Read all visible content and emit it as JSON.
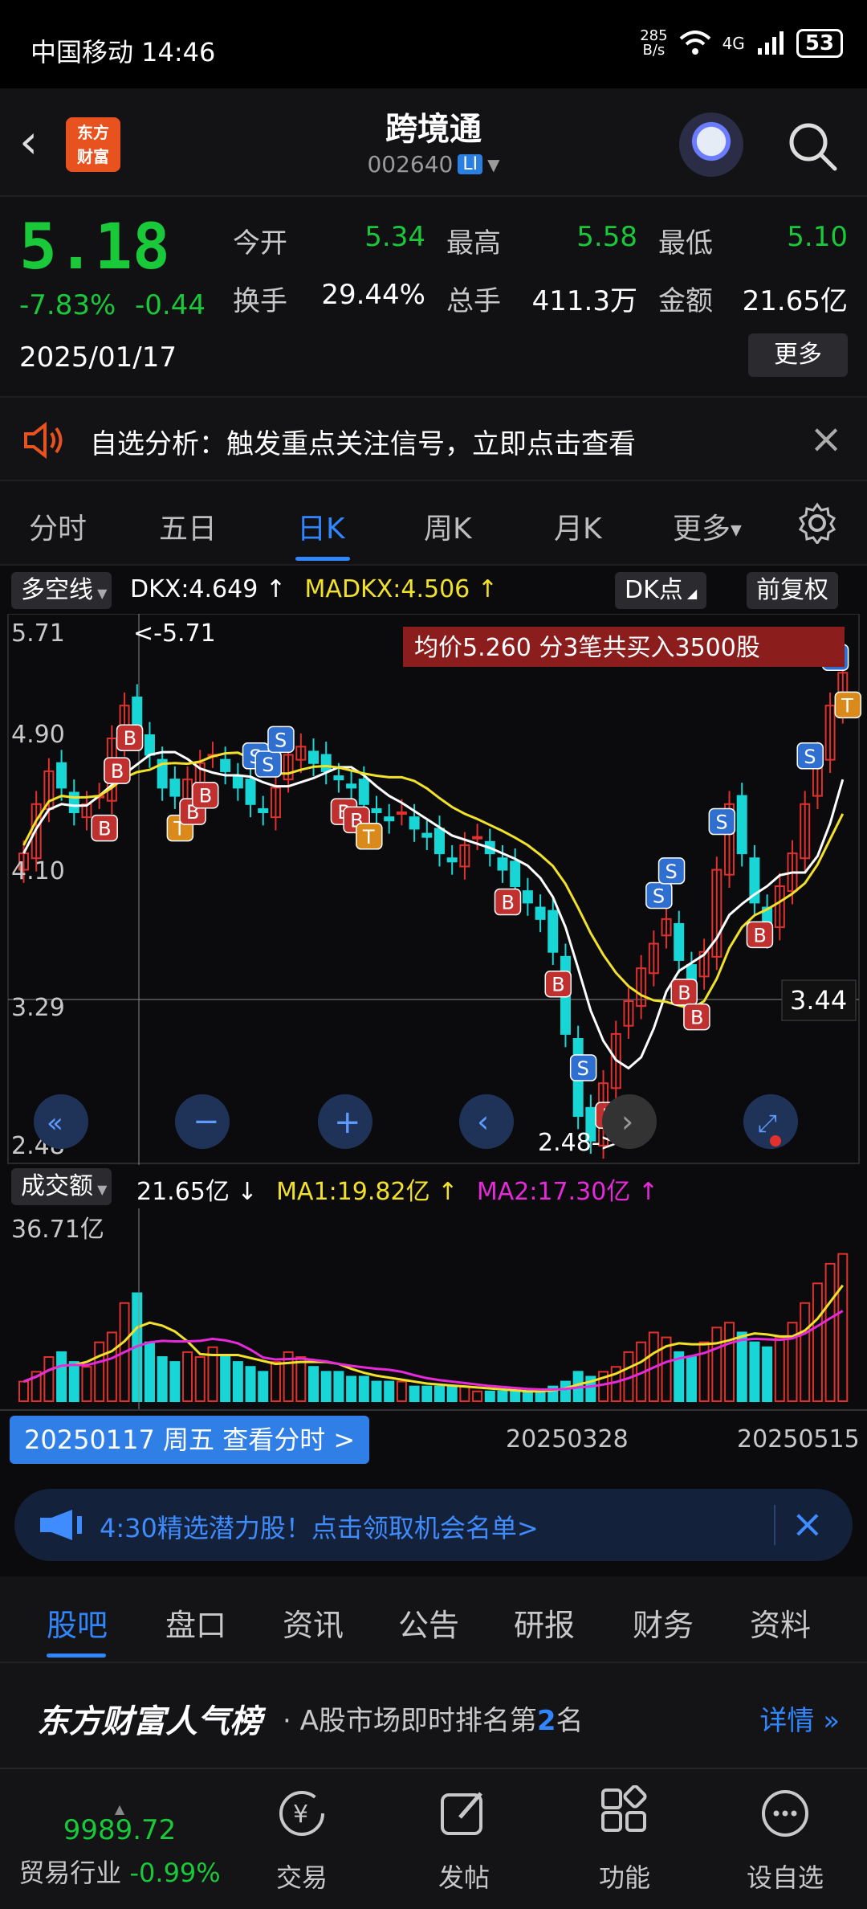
{
  "status_bar": {
    "carrier_time": "中国移动 14:46",
    "net_speed": "285\nB/s",
    "signal_label": "4G",
    "battery": "53"
  },
  "header": {
    "title": "跨境通",
    "code": "002640",
    "badge": "LI",
    "logo_text": "东方\n财富"
  },
  "quote": {
    "price": "5.18",
    "change_pct": "-7.83%",
    "change": "-0.44",
    "date": "2025/01/17",
    "open_label": "今开",
    "open": "5.34",
    "high_label": "最高",
    "high": "5.58",
    "low_label": "最低",
    "low": "5.10",
    "turnover_label": "换手",
    "turnover": "29.44%",
    "volume_label": "总手",
    "volume": "411.3万",
    "amount_label": "金额",
    "amount": "21.65亿",
    "more_label": "更多"
  },
  "notice": {
    "text": "自选分析：触发重点关注信号，立即点击查看"
  },
  "chart_tabs": [
    "分时",
    "五日",
    "日K",
    "周K",
    "月K",
    "更多"
  ],
  "indicator": {
    "selector": "多空线",
    "dkx": "DKX:4.649 ↑",
    "madkx": "MADKX:4.506 ↑",
    "dk_point": "DK点",
    "adjust": "前复权"
  },
  "price_axis": {
    "top": "5.71",
    "mid1": "4.90",
    "mid2": "4.10",
    "mid3": "3.29",
    "bottom": "2.48"
  },
  "annotations": {
    "high_marker": "<-5.71",
    "low_marker": "2.48->",
    "cursor_price": "3.44",
    "trade_banner": "均价5.260  分3笔共买入3500股"
  },
  "volume": {
    "selector": "成交额",
    "current": "21.65亿 ↓",
    "ma1": "MA1:19.82亿 ↑",
    "ma2": "MA2:17.30亿 ↑",
    "axis_max": "36.71亿"
  },
  "date_bar": {
    "selected": "20250117 周五 查看分时 >",
    "d1": "20250328",
    "d2": "20250515"
  },
  "banner": {
    "text": "4:30精选潜力股！点击领取机会名单>"
  },
  "bottom_tabs": [
    "股吧",
    "盘口",
    "资讯",
    "公告",
    "研报",
    "财务",
    "资料"
  ],
  "rank": {
    "title": "东方财富人气榜",
    "sub_prefix": "· A股市场即时排名第",
    "rank_num": "2",
    "sub_suffix": "名",
    "detail": "详情"
  },
  "bottom_nav": {
    "index_value": "9989.72",
    "index_name": "贸易行业",
    "index_change": "-0.99%",
    "items": [
      "交易",
      "发帖",
      "功能",
      "设自选"
    ]
  },
  "colors": {
    "up": "#e0312e",
    "down": "#19c93a",
    "accent": "#2f86ff",
    "ma_white": "#ffffff",
    "ma_yellow": "#f2e12a",
    "ma_magenta": "#e629d9",
    "vol_down": "#19d6d6"
  },
  "chart_data": {
    "type": "candlestick",
    "ylim": [
      2.48,
      5.71
    ],
    "close": [
      4.3,
      4.6,
      4.8,
      4.7,
      4.55,
      4.6,
      4.65,
      5.0,
      5.2,
      5.05,
      4.9,
      4.7,
      4.65,
      4.75,
      4.85,
      4.9,
      4.8,
      4.7,
      4.6,
      4.55,
      4.7,
      4.9,
      4.95,
      4.85,
      4.8,
      4.75,
      4.7,
      4.6,
      4.55,
      4.5,
      4.55,
      4.45,
      4.4,
      4.3,
      4.25,
      4.35,
      4.4,
      4.3,
      4.2,
      4.1,
      4.0,
      3.9,
      3.7,
      3.2,
      2.7,
      2.55,
      2.9,
      3.2,
      3.4,
      3.6,
      3.75,
      3.9,
      3.65,
      3.5,
      3.7,
      4.2,
      4.6,
      4.3,
      4.0,
      3.8,
      4.1,
      4.3,
      4.6,
      4.9,
      5.2,
      5.4
    ],
    "volume": [
      4,
      6,
      9,
      10,
      8,
      7,
      12,
      14,
      20,
      22,
      12,
      9,
      8,
      10,
      9,
      11,
      9,
      8,
      7,
      6,
      8,
      10,
      9,
      7,
      6,
      6,
      5,
      5,
      4,
      4,
      4,
      3,
      3,
      3,
      3,
      3,
      2,
      2,
      2,
      2,
      2,
      2,
      3,
      4,
      6,
      5,
      6,
      7,
      10,
      12,
      14,
      13,
      10,
      9,
      12,
      15,
      16,
      14,
      12,
      11,
      13,
      16,
      20,
      24,
      28,
      30
    ]
  }
}
